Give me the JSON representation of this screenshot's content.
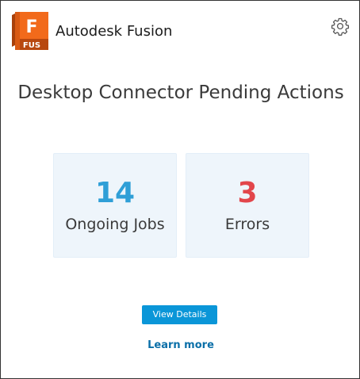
{
  "header": {
    "logo_text": "F",
    "logo_subtext": "FUS",
    "app_title": "Autodesk Fusion",
    "settings_icon": "gear-icon"
  },
  "main": {
    "title": "Desktop Connector Pending Actions",
    "cards": [
      {
        "count": "14",
        "label": "Ongoing Jobs",
        "color": "#2f9fd7"
      },
      {
        "count": "3",
        "label": "Errors",
        "color": "#e2464b"
      }
    ],
    "view_details_label": "View Details",
    "learn_more_label": "Learn more"
  },
  "colors": {
    "accent_button": "#0a96d8",
    "link": "#0a6fa8",
    "logo_orange": "#f26a1b",
    "logo_dark": "#a8410c",
    "card_bg": "#eef5fb"
  }
}
